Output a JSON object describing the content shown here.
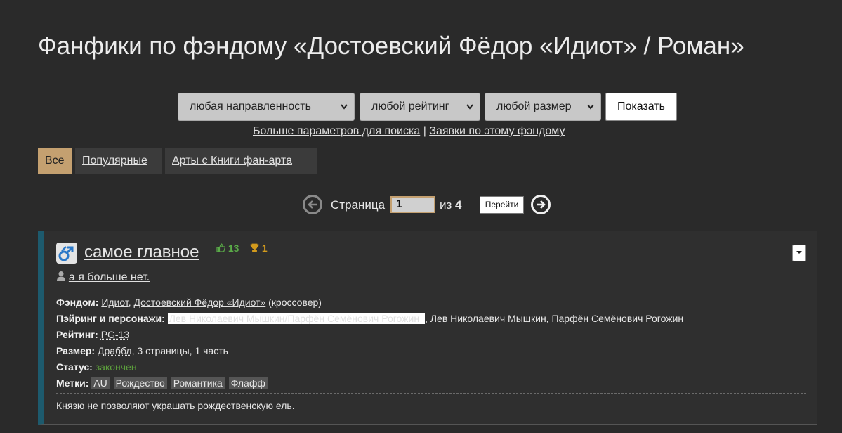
{
  "page": {
    "title": "Фанфики по фэндому «Достоевский Фёдор «Идиот» / Роман»"
  },
  "filters": {
    "direction": "любая направленность",
    "rating": "любой рейтинг",
    "size": "любой размер",
    "show_button": "Показать"
  },
  "sublinks": {
    "more_params": "Больше параметров для поиска",
    "separator": "|",
    "requests": "Заявки по этому фэндому"
  },
  "tabs": [
    {
      "label": "Все",
      "active": true
    },
    {
      "label": "Популярные",
      "active": false
    },
    {
      "label": "Арты с Книги фан-арта",
      "active": false
    }
  ],
  "pagination": {
    "label": "Страница",
    "current": "1",
    "of_label": "из",
    "total": "4",
    "go_button": "Перейти"
  },
  "fanfic": {
    "title": "самое главное",
    "likes": "13",
    "awards": "1",
    "author": "а я больше нет.",
    "fandom_label": "Фэндом:",
    "fandom_1": "Идиот",
    "fandom_sep": ",",
    "fandom_2": "Достоевский Фёдор «Идиот»",
    "fandom_note": "(кроссовер)",
    "pairing_label": "Пэйринг и персонажи:",
    "pairing": "Лев Николаевич Мышкин/Парфён Семёнович Рогожин",
    "characters": ", Лев Николаевич Мышкин, Парфён Семёнович Рогожин",
    "rating_label": "Рейтинг:",
    "rating": "PG-13",
    "size_label": "Размер:",
    "size": "Драббл",
    "size_details": ", 3 страницы, 1 часть",
    "status_label": "Статус:",
    "status": "закончен",
    "tags_label": "Метки:",
    "tags": [
      "AU",
      "Рождество",
      "Романтика",
      "Флафф"
    ],
    "summary": "Князю не позволяют украшать рождественскую ель."
  },
  "colors": {
    "background": "#2a2a2a",
    "accent_tab": "#c4a070",
    "card_stripe": "#1d5a6d",
    "likes": "#5aab48",
    "awards": "#d39b1d",
    "status_done": "#5c9e3c"
  }
}
